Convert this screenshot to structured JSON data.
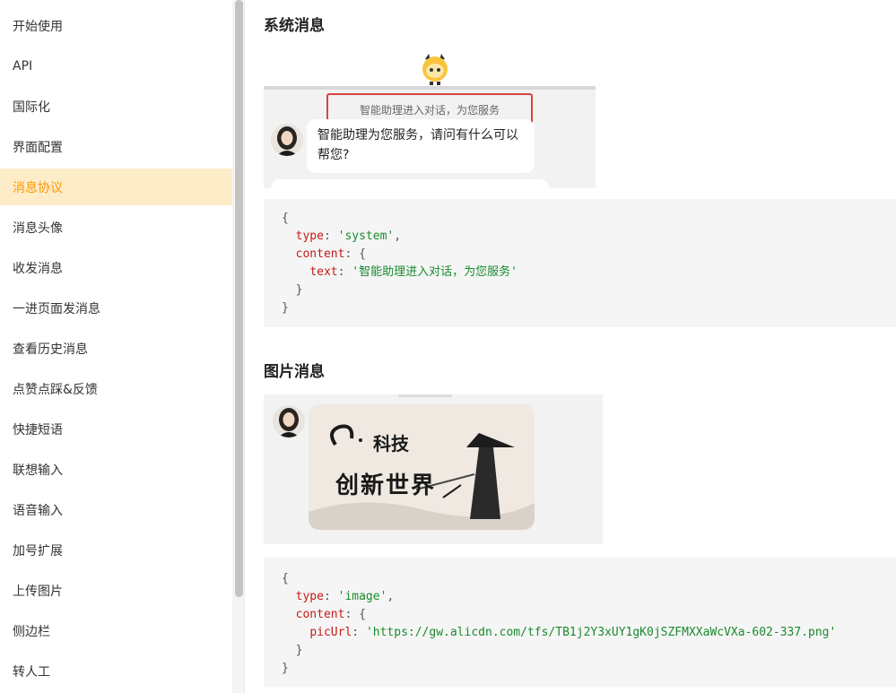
{
  "sidebar": {
    "items": [
      {
        "label": "开始使用"
      },
      {
        "label": "API"
      },
      {
        "label": "国际化"
      },
      {
        "label": "界面配置"
      },
      {
        "label": "消息协议"
      },
      {
        "label": "消息头像"
      },
      {
        "label": "收发消息"
      },
      {
        "label": "一进页面发消息"
      },
      {
        "label": "查看历史消息"
      },
      {
        "label": "点赞点踩&反馈"
      },
      {
        "label": "快捷短语"
      },
      {
        "label": "联想输入"
      },
      {
        "label": "语音输入"
      },
      {
        "label": "加号扩展"
      },
      {
        "label": "上传图片"
      },
      {
        "label": "侧边栏"
      },
      {
        "label": "转人工"
      }
    ],
    "active_item": "消息协议",
    "active_color": "#ff9800"
  },
  "system_section": {
    "title": "系统消息",
    "demo": {
      "system_text": "智能助理进入对话，为您服务",
      "bubble_text": "智能助理为您服务，请问有什么可以帮您?"
    },
    "code": {
      "open": "{",
      "type_key": "type",
      "type_value": "'system'",
      "content_key": "content",
      "text_key": "text",
      "text_value": "'智能助理进入对话，为您服务'",
      "close_inner": "}",
      "close": "}"
    }
  },
  "image_section": {
    "title": "图片消息",
    "demo": {
      "image_text_line1": "科技",
      "image_text_line2": "创新世界"
    },
    "code": {
      "open": "{",
      "type_key": "type",
      "type_value": "'image'",
      "content_key": "content",
      "pic_key": "picUrl",
      "pic_value": "'https://gw.alicdn.com/tfs/TB1j2Y3xUY1gK0jSZFMXXaWcVXa-602-337.png'",
      "close_inner": "}",
      "close": "}"
    }
  },
  "colors": {
    "highlight_border": "#d9453a",
    "string_green": "#1a8a2e",
    "key_red": "#c41a16"
  }
}
